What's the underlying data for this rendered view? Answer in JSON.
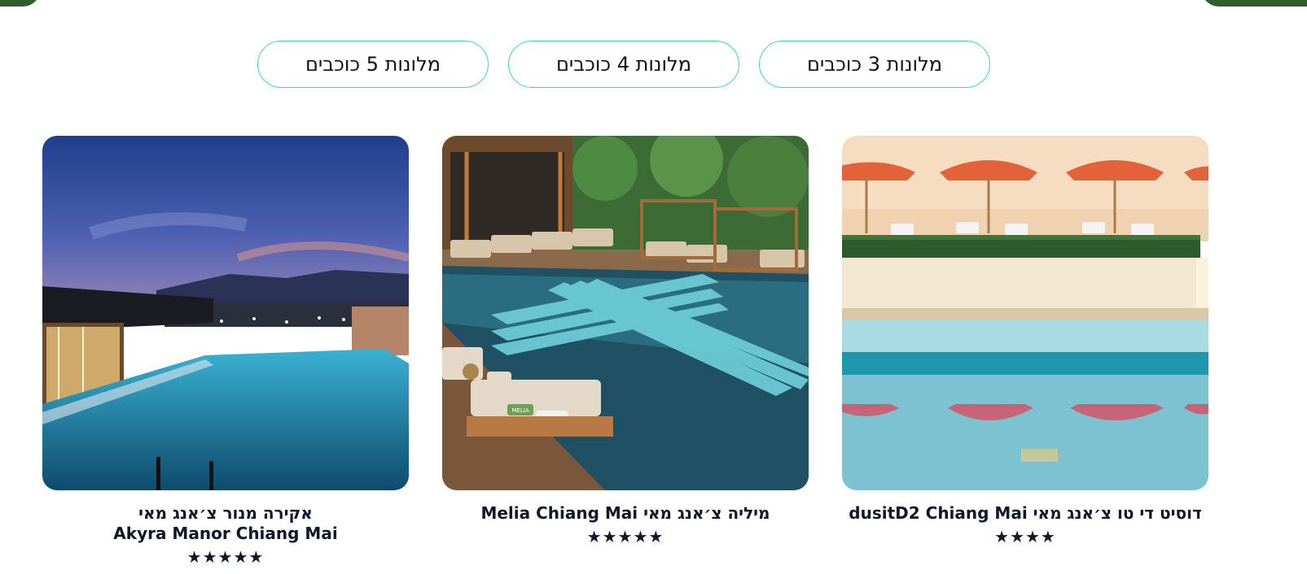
{
  "filters": [
    {
      "label": "מלונות 3 כוכבים"
    },
    {
      "label": "מלונות 4 כוכבים"
    },
    {
      "label": "מלונות 5 כוכבים"
    }
  ],
  "hotels": [
    {
      "title": "דוסיט די טו צ׳אנג מאי dusitD2 Chiang Mai",
      "title_line2": "",
      "stars": 4,
      "stars_display": "★★★★"
    },
    {
      "title": "מיליה צ׳אנג מאי Melia Chiang Mai",
      "title_line2": "",
      "stars": 5,
      "stars_display": "★★★★★"
    },
    {
      "title": "אקירה מנור צ׳אנג מאי",
      "title_line2": "Akyra Manor Chiang Mai",
      "stars": 5,
      "stars_display": "★★★★★"
    }
  ],
  "photo_text": {
    "cushion": "MELIA"
  },
  "colors": {
    "accent_border": "#3fd6b4",
    "text": "#0f172a",
    "corner_green": "#2f5e2b"
  }
}
